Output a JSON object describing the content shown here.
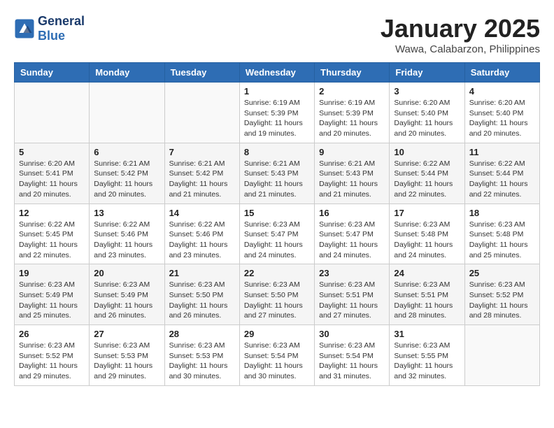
{
  "header": {
    "logo_line1": "General",
    "logo_line2": "Blue",
    "month": "January 2025",
    "location": "Wawa, Calabarzon, Philippines"
  },
  "weekdays": [
    "Sunday",
    "Monday",
    "Tuesday",
    "Wednesday",
    "Thursday",
    "Friday",
    "Saturday"
  ],
  "weeks": [
    [
      {
        "day": "",
        "info": ""
      },
      {
        "day": "",
        "info": ""
      },
      {
        "day": "",
        "info": ""
      },
      {
        "day": "1",
        "info": "Sunrise: 6:19 AM\nSunset: 5:39 PM\nDaylight: 11 hours\nand 19 minutes."
      },
      {
        "day": "2",
        "info": "Sunrise: 6:19 AM\nSunset: 5:39 PM\nDaylight: 11 hours\nand 20 minutes."
      },
      {
        "day": "3",
        "info": "Sunrise: 6:20 AM\nSunset: 5:40 PM\nDaylight: 11 hours\nand 20 minutes."
      },
      {
        "day": "4",
        "info": "Sunrise: 6:20 AM\nSunset: 5:40 PM\nDaylight: 11 hours\nand 20 minutes."
      }
    ],
    [
      {
        "day": "5",
        "info": "Sunrise: 6:20 AM\nSunset: 5:41 PM\nDaylight: 11 hours\nand 20 minutes."
      },
      {
        "day": "6",
        "info": "Sunrise: 6:21 AM\nSunset: 5:42 PM\nDaylight: 11 hours\nand 20 minutes."
      },
      {
        "day": "7",
        "info": "Sunrise: 6:21 AM\nSunset: 5:42 PM\nDaylight: 11 hours\nand 21 minutes."
      },
      {
        "day": "8",
        "info": "Sunrise: 6:21 AM\nSunset: 5:43 PM\nDaylight: 11 hours\nand 21 minutes."
      },
      {
        "day": "9",
        "info": "Sunrise: 6:21 AM\nSunset: 5:43 PM\nDaylight: 11 hours\nand 21 minutes."
      },
      {
        "day": "10",
        "info": "Sunrise: 6:22 AM\nSunset: 5:44 PM\nDaylight: 11 hours\nand 22 minutes."
      },
      {
        "day": "11",
        "info": "Sunrise: 6:22 AM\nSunset: 5:44 PM\nDaylight: 11 hours\nand 22 minutes."
      }
    ],
    [
      {
        "day": "12",
        "info": "Sunrise: 6:22 AM\nSunset: 5:45 PM\nDaylight: 11 hours\nand 22 minutes."
      },
      {
        "day": "13",
        "info": "Sunrise: 6:22 AM\nSunset: 5:46 PM\nDaylight: 11 hours\nand 23 minutes."
      },
      {
        "day": "14",
        "info": "Sunrise: 6:22 AM\nSunset: 5:46 PM\nDaylight: 11 hours\nand 23 minutes."
      },
      {
        "day": "15",
        "info": "Sunrise: 6:23 AM\nSunset: 5:47 PM\nDaylight: 11 hours\nand 24 minutes."
      },
      {
        "day": "16",
        "info": "Sunrise: 6:23 AM\nSunset: 5:47 PM\nDaylight: 11 hours\nand 24 minutes."
      },
      {
        "day": "17",
        "info": "Sunrise: 6:23 AM\nSunset: 5:48 PM\nDaylight: 11 hours\nand 24 minutes."
      },
      {
        "day": "18",
        "info": "Sunrise: 6:23 AM\nSunset: 5:48 PM\nDaylight: 11 hours\nand 25 minutes."
      }
    ],
    [
      {
        "day": "19",
        "info": "Sunrise: 6:23 AM\nSunset: 5:49 PM\nDaylight: 11 hours\nand 25 minutes."
      },
      {
        "day": "20",
        "info": "Sunrise: 6:23 AM\nSunset: 5:49 PM\nDaylight: 11 hours\nand 26 minutes."
      },
      {
        "day": "21",
        "info": "Sunrise: 6:23 AM\nSunset: 5:50 PM\nDaylight: 11 hours\nand 26 minutes."
      },
      {
        "day": "22",
        "info": "Sunrise: 6:23 AM\nSunset: 5:50 PM\nDaylight: 11 hours\nand 27 minutes."
      },
      {
        "day": "23",
        "info": "Sunrise: 6:23 AM\nSunset: 5:51 PM\nDaylight: 11 hours\nand 27 minutes."
      },
      {
        "day": "24",
        "info": "Sunrise: 6:23 AM\nSunset: 5:51 PM\nDaylight: 11 hours\nand 28 minutes."
      },
      {
        "day": "25",
        "info": "Sunrise: 6:23 AM\nSunset: 5:52 PM\nDaylight: 11 hours\nand 28 minutes."
      }
    ],
    [
      {
        "day": "26",
        "info": "Sunrise: 6:23 AM\nSunset: 5:52 PM\nDaylight: 11 hours\nand 29 minutes."
      },
      {
        "day": "27",
        "info": "Sunrise: 6:23 AM\nSunset: 5:53 PM\nDaylight: 11 hours\nand 29 minutes."
      },
      {
        "day": "28",
        "info": "Sunrise: 6:23 AM\nSunset: 5:53 PM\nDaylight: 11 hours\nand 30 minutes."
      },
      {
        "day": "29",
        "info": "Sunrise: 6:23 AM\nSunset: 5:54 PM\nDaylight: 11 hours\nand 30 minutes."
      },
      {
        "day": "30",
        "info": "Sunrise: 6:23 AM\nSunset: 5:54 PM\nDaylight: 11 hours\nand 31 minutes."
      },
      {
        "day": "31",
        "info": "Sunrise: 6:23 AM\nSunset: 5:55 PM\nDaylight: 11 hours\nand 32 minutes."
      },
      {
        "day": "",
        "info": ""
      }
    ]
  ]
}
